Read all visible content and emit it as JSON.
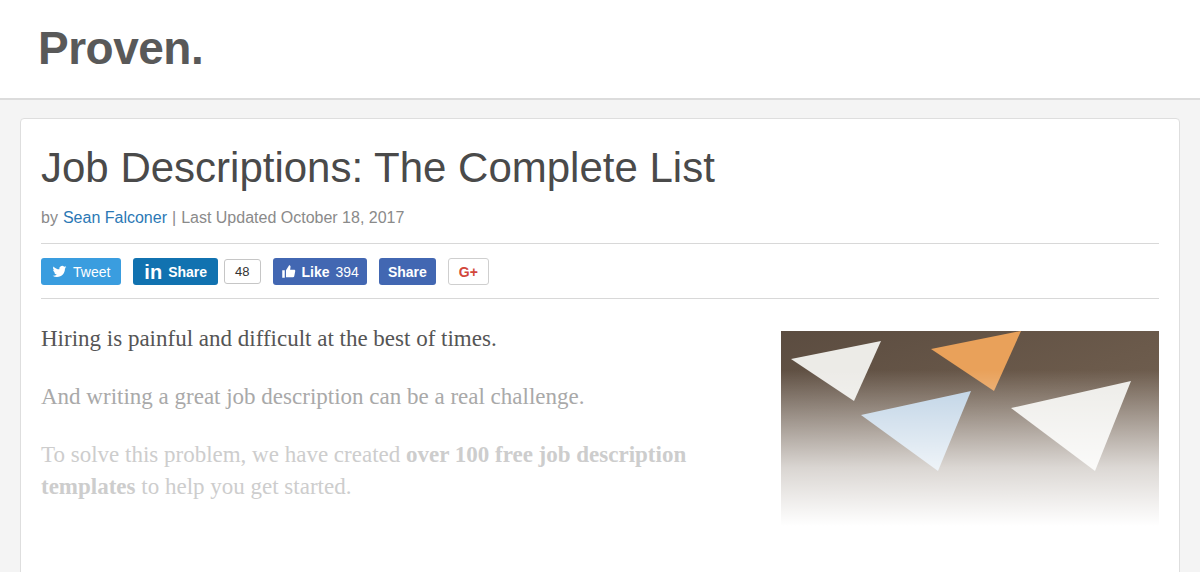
{
  "header": {
    "logo": "Proven."
  },
  "article": {
    "title": "Job Descriptions: The Complete List",
    "byline": {
      "prefix": "by",
      "author": "Sean Falconer",
      "separator": "|",
      "updated": "Last Updated October 18, 2017"
    }
  },
  "share_buttons": [
    {
      "kind": "twitter",
      "label": "Tweet"
    },
    {
      "kind": "linkedin",
      "icon": "in",
      "label": "Share",
      "count": "48"
    },
    {
      "kind": "facebook-like",
      "label": "Like",
      "count": "394"
    },
    {
      "kind": "facebook-share",
      "label": "Share"
    },
    {
      "kind": "google-plus",
      "label": "G+"
    }
  ],
  "paragraphs": [
    {
      "fade": 0,
      "segments": [
        {
          "text": "Hiring is painful and difficult at the best of times.",
          "bold": false
        }
      ]
    },
    {
      "fade": 0.7,
      "segments": [
        {
          "text": "And writing a great job description can be a real challenge.",
          "bold": false
        }
      ]
    },
    {
      "fade": 1,
      "segments": [
        {
          "text": "To solve this problem, we have created ",
          "bold": false
        },
        {
          "text": "over 100 free job description templates",
          "bold": true
        },
        {
          "text": " to help you get started.",
          "bold": false
        }
      ]
    }
  ]
}
